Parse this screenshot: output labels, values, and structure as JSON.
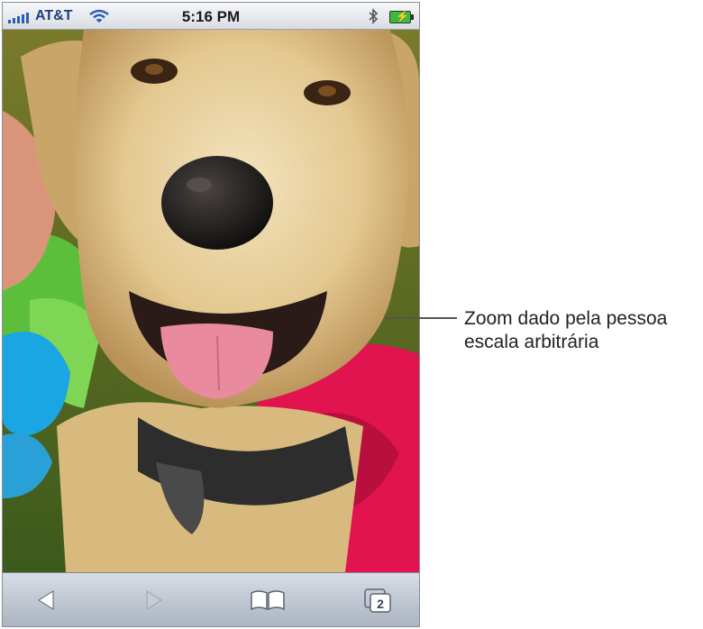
{
  "status_bar": {
    "carrier": "AT&T",
    "time": "5:16 PM"
  },
  "icons": {
    "signal": "signal-bars-icon",
    "wifi": "wifi-icon",
    "bluetooth": "bluetooth-icon",
    "battery": "battery-charging-icon",
    "back": "back-arrow-icon",
    "forward": "forward-arrow-icon",
    "bookmarks": "bookmarks-book-icon",
    "pages": "pages-icon"
  },
  "toolbar": {
    "pages_count": "2"
  },
  "annotation": {
    "line1": "Zoom dado pela pessoa",
    "line2": "escala arbitrária"
  },
  "colors": {
    "status_bar_bg": "#e6e9ee",
    "toolbar_bg": "#bcc4cf",
    "carrier_text": "#1e3f7a",
    "battery": "#3cba3c"
  }
}
